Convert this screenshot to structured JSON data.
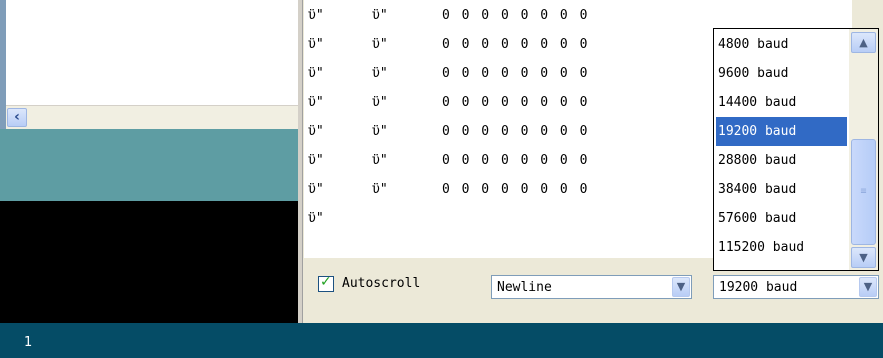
{
  "editor": {
    "scroll_left_icon": "chevron-left-icon"
  },
  "output": {
    "lines": [
      {
        "a": "ϋ\"",
        "b": "ϋ\"",
        "c": "0 0 0 0 0 0 0 0"
      },
      {
        "a": "ϋ\"",
        "b": "ϋ\"",
        "c": "0 0 0 0 0 0 0 0"
      },
      {
        "a": "ϋ\"",
        "b": "ϋ\"",
        "c": "0 0 0 0 0 0 0 0"
      },
      {
        "a": "ϋ\"",
        "b": "ϋ\"",
        "c": "0 0 0 0 0 0 0 0"
      },
      {
        "a": "ϋ\"",
        "b": "ϋ\"",
        "c": "0 0 0 0 0 0 0 0"
      },
      {
        "a": "ϋ\"",
        "b": "ϋ\"",
        "c": "0 0 0 0 0 0 0 0"
      },
      {
        "a": "ϋ\"",
        "b": "ϋ\"",
        "c": "0 0 0 0 0 0 0 0"
      },
      {
        "a": "ϋ\"",
        "b": "",
        "c": ""
      }
    ]
  },
  "controls": {
    "autoscroll_label": "Autoscroll",
    "autoscroll_checked": true,
    "line_ending_value": "Newline",
    "baud_value": "19200 baud"
  },
  "baud_dropdown": {
    "options": [
      "4800 baud",
      "9600 baud",
      "14400 baud",
      "19200 baud",
      "28800 baud",
      "38400 baud",
      "57600 baud",
      "115200 baud"
    ],
    "selected": "19200 baud"
  },
  "status": {
    "line_number": "1"
  },
  "colors": {
    "teal": "#5e9da3",
    "status_bar": "#054c66",
    "selection": "#316ac5"
  }
}
